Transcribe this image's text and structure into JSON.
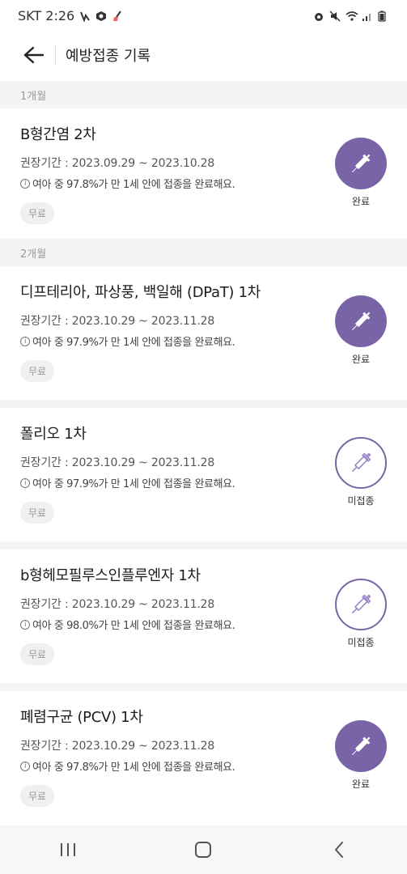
{
  "status_bar": {
    "carrier_time": "SKT 2:26"
  },
  "header": {
    "title": "예방접종 기록"
  },
  "sections": [
    {
      "label": "1개월",
      "items": [
        {
          "title": "B형간염 2차",
          "period": "권장기간 : 2023.09.29 ~ 2023.10.28",
          "note": "여아 중 97.8%가 만 1세 안에 접종을 완료해요.",
          "badge": "무료",
          "status": "완료",
          "state": "done"
        }
      ]
    },
    {
      "label": "2개월",
      "items": [
        {
          "title": "디프테리아, 파상풍, 백일해 (DPaT) 1차",
          "period": "권장기간 : 2023.10.29 ~ 2023.11.28",
          "note": "여아 중 97.9%가 만 1세 안에 접종을 완료해요.",
          "badge": "무료",
          "status": "완료",
          "state": "done"
        },
        {
          "title": "폴리오 1차",
          "period": "권장기간 : 2023.10.29 ~ 2023.11.28",
          "note": "여아 중 97.9%가 만 1세 안에 접종을 완료해요.",
          "badge": "무료",
          "status": "미접종",
          "state": "pending"
        },
        {
          "title": "b형헤모필루스인플루엔자 1차",
          "period": "권장기간 : 2023.10.29 ~ 2023.11.28",
          "note": "여아 중 98.0%가 만 1세 안에 접종을 완료해요.",
          "badge": "무료",
          "status": "미접종",
          "state": "pending"
        },
        {
          "title": "폐렴구균 (PCV) 1차",
          "period": "권장기간 : 2023.10.29 ~ 2023.11.28",
          "note": "여아 중 97.8%가 만 1세 안에 접종을 완료해요.",
          "badge": "무료",
          "status": "완료",
          "state": "done"
        }
      ]
    }
  ],
  "icons": {
    "done_icon": "syringe-filled-icon",
    "pending_icon": "syringe-outline-icon",
    "info_icon": "info-icon"
  },
  "colors": {
    "accent": "#7a64a8",
    "section_bg": "#f4f4f6"
  }
}
